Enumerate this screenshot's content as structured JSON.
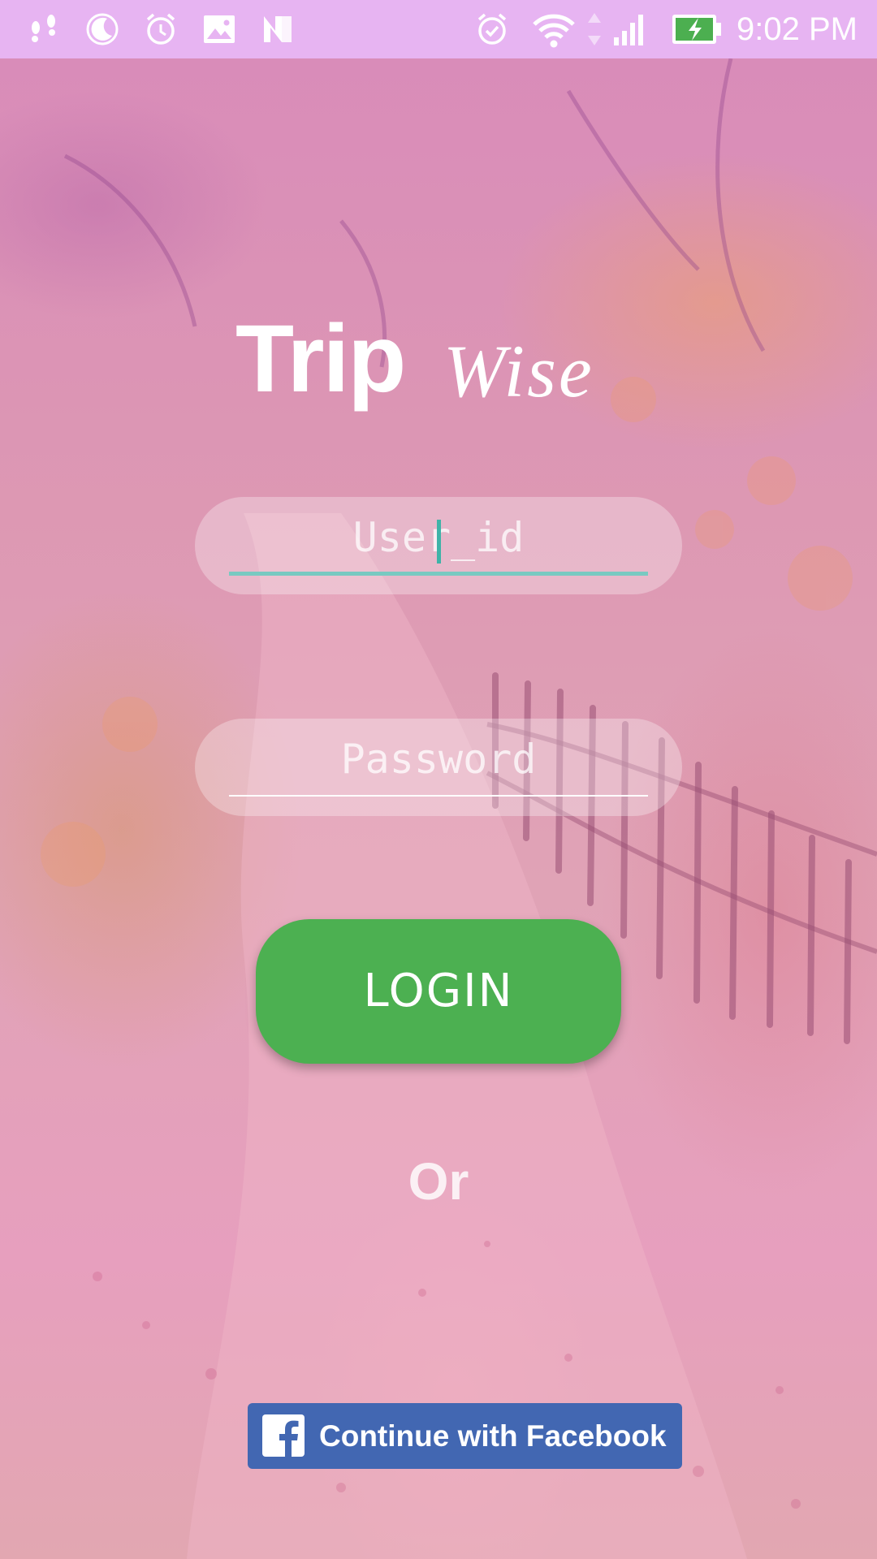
{
  "status_bar": {
    "time": "9:02 PM",
    "background_color": "#e7b4f2",
    "left_icons": [
      "footprints-icon",
      "moon-icon",
      "alarm-clock-icon",
      "image-icon",
      "n-logo-icon"
    ],
    "right_icons": [
      "alarm-check-icon",
      "wifi-icon",
      "signal-icon",
      "battery-charging-icon"
    ]
  },
  "title": {
    "first": "Trip",
    "second": "Wise"
  },
  "form": {
    "user_id_placeholder": "User_id",
    "password_placeholder": "Password",
    "active_underline_color": "#78c9c1"
  },
  "login": {
    "label": "LOGIN",
    "color": "#4cb051"
  },
  "separator": "Or",
  "facebook": {
    "label": "Continue with Facebook",
    "color": "#4267b2"
  }
}
